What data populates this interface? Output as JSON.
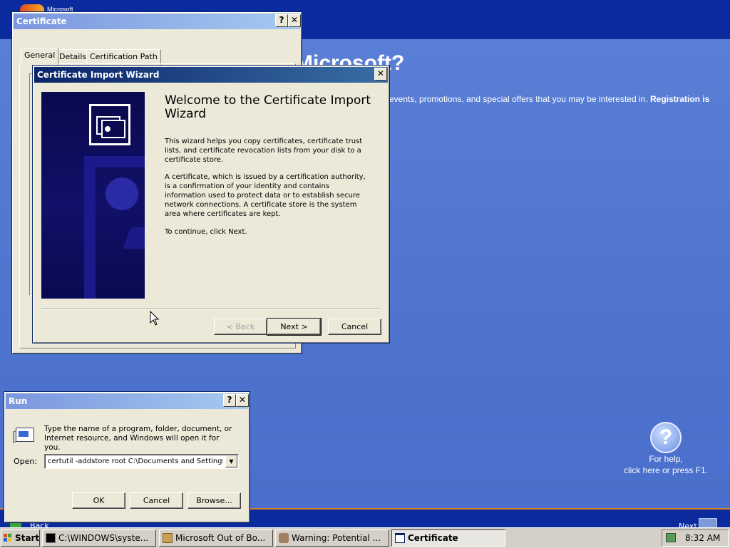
{
  "desktop": {
    "brand_text": "Microsoft",
    "heading_fragment": "Microsoft?",
    "info_text": "events, promotions, and special offers that you may be interested in.",
    "info_bold": "Registration is",
    "help_line1": "For help,",
    "help_line2": "click here or press F1.",
    "help_symbol": "?",
    "back_label": "Back",
    "next_label": "Next"
  },
  "certificate_window": {
    "title": "Certificate",
    "tabs": [
      {
        "label": "General",
        "active": true
      },
      {
        "label": "Details",
        "active": false
      },
      {
        "label": "Certification Path",
        "active": false
      }
    ]
  },
  "wizard": {
    "title": "Certificate Import Wizard",
    "heading": "Welcome to the Certificate Import Wizard",
    "para1": "This wizard helps you copy certificates, certificate trust lists, and certificate revocation lists from your disk to a certificate store.",
    "para2": "A certificate, which is issued by a certification authority, is a confirmation of your identity and contains information used to protect data or to establish secure network connections. A certificate store is the system area where certificates are kept.",
    "para3": "To continue, click Next.",
    "back_button": "< Back",
    "next_button": "Next >",
    "cancel_button": "Cancel"
  },
  "run_dialog": {
    "title": "Run",
    "description": "Type the name of a program, folder, document, or Internet resource, and Windows will open it for you.",
    "open_label": "Open:",
    "open_value": "certutil -addstore root C:\\Documents and Settings\\A",
    "ok_button": "OK",
    "cancel_button": "Cancel",
    "browse_button": "Browse..."
  },
  "taskbar": {
    "start_label": "Start",
    "tasks": [
      {
        "label": "C:\\WINDOWS\\syste...",
        "icon": "console-icon",
        "active": false
      },
      {
        "label": "Microsoft Out of Bo...",
        "icon": "setup-icon",
        "active": false
      },
      {
        "label": "Warning: Potential ...",
        "icon": "warning-icon",
        "active": false
      },
      {
        "label": "Certificate",
        "icon": "window-icon",
        "active": true
      }
    ],
    "clock": "8:32 AM"
  },
  "colors": {
    "desktop_blue": "#5a7fd6",
    "titlebar_active": "#0a246a",
    "titlebar_inactive": "#7a96df",
    "window_face": "#ece9d8"
  }
}
